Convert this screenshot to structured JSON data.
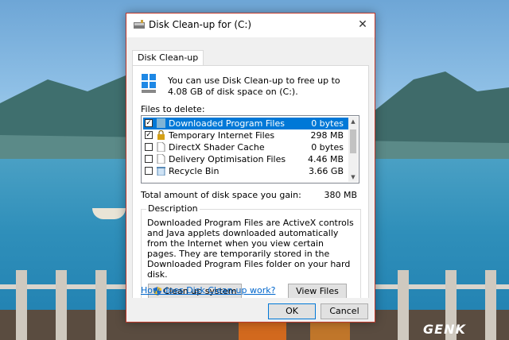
{
  "window": {
    "title": "Disk Clean-up for  (C:)",
    "close_glyph": "✕"
  },
  "tabs": [
    {
      "label": "Disk Clean-up"
    }
  ],
  "intro_text": "You can use Disk Clean-up to free up to 4.08 GB of disk space on  (C:).",
  "files_label": "Files to delete:",
  "files": [
    {
      "name": "Downloaded Program Files",
      "size": "0 bytes",
      "checked": true,
      "selected": true,
      "icon": "folder-icon"
    },
    {
      "name": "Temporary Internet Files",
      "size": "298 MB",
      "checked": true,
      "selected": false,
      "icon": "lock-icon"
    },
    {
      "name": "DirectX Shader Cache",
      "size": "0 bytes",
      "checked": false,
      "selected": false,
      "icon": "file-icon"
    },
    {
      "name": "Delivery Optimisation Files",
      "size": "4.46 MB",
      "checked": false,
      "selected": false,
      "icon": "file-icon"
    },
    {
      "name": "Recycle Bin",
      "size": "3.66 GB",
      "checked": false,
      "selected": false,
      "icon": "recycle-bin-icon"
    }
  ],
  "total": {
    "label": "Total amount of disk space you gain:",
    "value": "380 MB"
  },
  "description": {
    "legend": "Description",
    "text": "Downloaded Program Files are ActiveX controls and Java applets downloaded automatically from the Internet when you view certain pages. They are temporarily stored in the Downloaded Program Files folder on your hard disk."
  },
  "buttons": {
    "cleanup_system": "Clean up system files",
    "view_files": "View Files",
    "ok": "OK",
    "cancel": "Cancel"
  },
  "help_link": "How does Disk Clean-up work?",
  "watermark": "GENK",
  "colors": {
    "selection": "#0078d7",
    "link": "#0066cc",
    "dialog_border": "#c0392b"
  }
}
